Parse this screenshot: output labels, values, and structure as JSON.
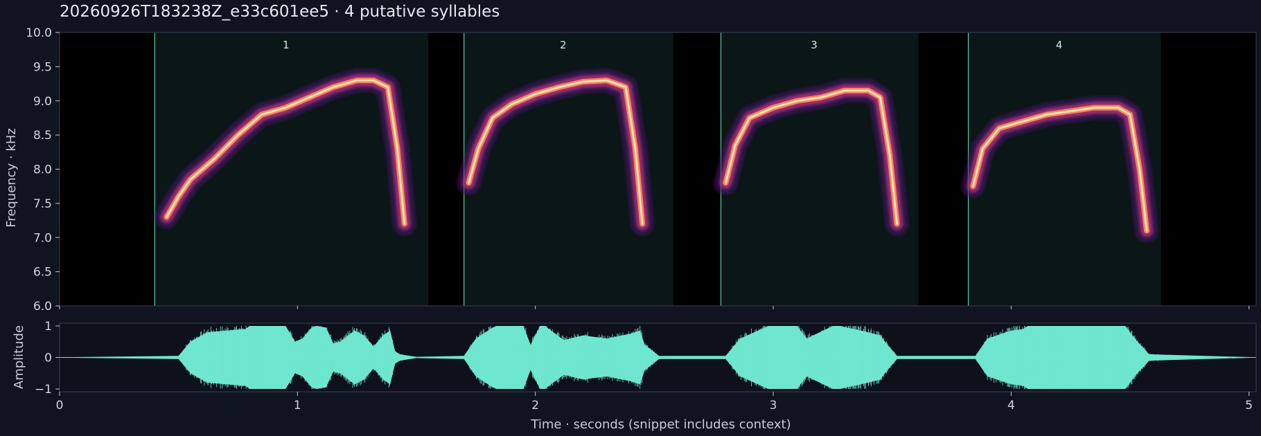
{
  "title": "20260926T183238Z_e33c601ee5  ·  4 putative syllables",
  "colors": {
    "background": "#101320",
    "plot_background": "#000000",
    "segment_fill": "#0b1616",
    "segment_line": "#5fc9a6",
    "waveform": "#6fe6cf",
    "spectrogram_colormap": "magma"
  },
  "chart_data": [
    {
      "type": "heatmap",
      "panel": "spectrogram",
      "ylabel": "Frequency · kHz",
      "xlim": [
        0,
        5.03
      ],
      "ylim": [
        6.0,
        10.0
      ],
      "yticks": [
        "6.0",
        "6.5",
        "7.0",
        "7.5",
        "8.0",
        "8.5",
        "9.0",
        "9.5",
        "10.0"
      ],
      "xticks": [
        1,
        2,
        3,
        4,
        5
      ],
      "segments": [
        {
          "label": "1",
          "start": 0.4,
          "end": 1.55
        },
        {
          "label": "2",
          "start": 1.7,
          "end": 2.58
        },
        {
          "label": "3",
          "start": 2.78,
          "end": 3.61
        },
        {
          "label": "4",
          "start": 3.82,
          "end": 4.63
        }
      ],
      "syllable_contours": [
        {
          "segment": "1",
          "t": [
            0.45,
            0.5,
            0.55,
            0.65,
            0.75,
            0.85,
            0.95,
            1.05,
            1.15,
            1.25,
            1.32,
            1.38,
            1.42,
            1.45
          ],
          "f": [
            7.3,
            7.6,
            7.85,
            8.15,
            8.5,
            8.8,
            8.9,
            9.05,
            9.2,
            9.3,
            9.3,
            9.2,
            8.3,
            7.2
          ]
        },
        {
          "segment": "2",
          "t": [
            1.72,
            1.76,
            1.82,
            1.9,
            2.0,
            2.1,
            2.2,
            2.3,
            2.38,
            2.42,
            2.45
          ],
          "f": [
            7.8,
            8.3,
            8.75,
            8.95,
            9.1,
            9.2,
            9.28,
            9.3,
            9.2,
            8.3,
            7.2
          ]
        },
        {
          "segment": "3",
          "t": [
            2.8,
            2.84,
            2.9,
            3.0,
            3.1,
            3.2,
            3.3,
            3.4,
            3.45,
            3.49,
            3.52
          ],
          "f": [
            7.8,
            8.35,
            8.75,
            8.9,
            9.0,
            9.05,
            9.15,
            9.15,
            9.05,
            8.2,
            7.2
          ]
        },
        {
          "segment": "4",
          "t": [
            3.84,
            3.88,
            3.95,
            4.05,
            4.15,
            4.25,
            4.35,
            4.45,
            4.5,
            4.54,
            4.57
          ],
          "f": [
            7.75,
            8.3,
            8.6,
            8.7,
            8.8,
            8.85,
            8.9,
            8.9,
            8.8,
            8.0,
            7.1
          ]
        }
      ]
    },
    {
      "type": "area",
      "panel": "waveform",
      "ylabel": "Amplitude",
      "xlabel": "Time · seconds (snippet includes context)",
      "xlim": [
        0,
        5.03
      ],
      "ylim": [
        -1,
        1
      ],
      "yticks": [
        "−1",
        "0",
        "1"
      ],
      "xticks": [
        "0",
        "1",
        "2",
        "3",
        "4",
        "5"
      ],
      "envelope": {
        "t": [
          0.0,
          0.5,
          0.55,
          0.62,
          0.7,
          0.78,
          0.8,
          0.95,
          0.99,
          1.02,
          1.06,
          1.08,
          1.12,
          1.15,
          1.18,
          1.24,
          1.28,
          1.32,
          1.36,
          1.39,
          1.41,
          1.43,
          1.5,
          1.7,
          1.75,
          1.82,
          1.84,
          1.95,
          1.98,
          2.02,
          2.04,
          2.12,
          2.2,
          2.3,
          2.4,
          2.44,
          2.46,
          2.52,
          2.8,
          2.86,
          2.95,
          2.98,
          3.1,
          3.14,
          3.25,
          3.28,
          3.4,
          3.45,
          3.47,
          3.52,
          3.85,
          3.9,
          4.0,
          4.05,
          4.07,
          4.48,
          4.52,
          4.58,
          5.03
        ],
        "amp": [
          0.0,
          0.05,
          0.5,
          0.8,
          0.85,
          0.9,
          1.0,
          1.0,
          0.5,
          0.6,
          0.95,
          1.0,
          0.95,
          0.45,
          0.5,
          0.85,
          0.7,
          0.35,
          0.7,
          0.85,
          0.2,
          0.1,
          0.02,
          0.05,
          0.6,
          0.95,
          1.0,
          1.0,
          0.4,
          1.0,
          1.0,
          0.55,
          0.7,
          0.6,
          0.75,
          0.85,
          0.4,
          0.05,
          0.05,
          0.6,
          0.9,
          1.0,
          1.0,
          0.6,
          1.0,
          1.0,
          0.8,
          0.7,
          0.5,
          0.05,
          0.05,
          0.6,
          0.85,
          0.9,
          1.0,
          1.0,
          0.6,
          0.1,
          0.0
        ]
      }
    }
  ]
}
